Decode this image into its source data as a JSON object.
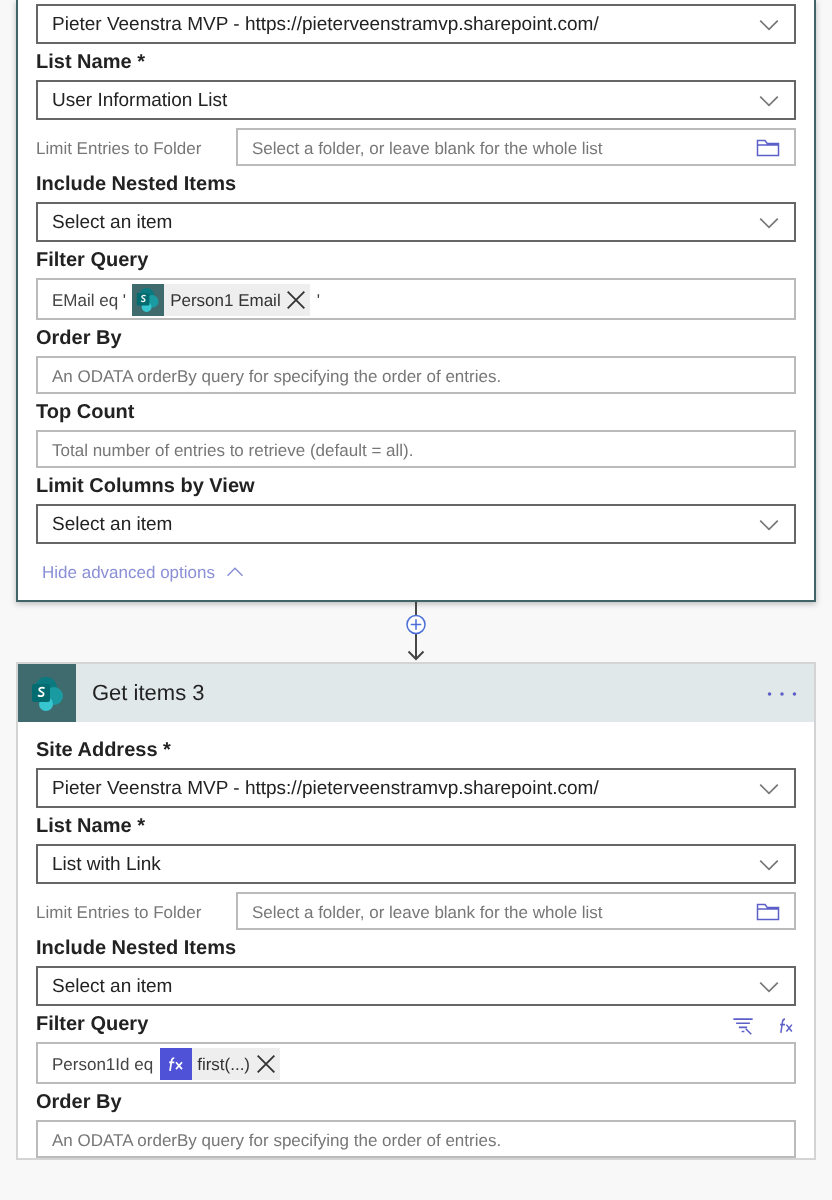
{
  "cards": [
    {
      "active": true,
      "fields": [
        {
          "kind": "dropdown",
          "value": "Pieter Veenstra MVP - https://pieterveenstramvp.sharepoint.com/"
        },
        {
          "kind": "dropdown",
          "label": "List Name *",
          "value": "User Information List"
        },
        {
          "kind": "folder",
          "label": "Limit Entries to Folder",
          "placeholder": "Select a folder, or leave blank for the whole list"
        },
        {
          "kind": "dropdown",
          "label": "Include Nested Items",
          "value": "Select an item"
        },
        {
          "kind": "tokens",
          "label": "Filter Query",
          "tools": false,
          "parts": [
            {
              "kind": "text",
              "text": "EMail eq '"
            },
            {
              "kind": "sharepoint",
              "text": "Person1 Email"
            },
            {
              "kind": "text",
              "text": "'"
            }
          ]
        },
        {
          "kind": "input",
          "label": "Order By",
          "placeholder": "An ODATA orderBy query for specifying the order of entries."
        },
        {
          "kind": "input",
          "label": "Top Count",
          "placeholder": "Total number of entries to retrieve (default = all)."
        },
        {
          "kind": "dropdown",
          "label": "Limit Columns by View",
          "value": "Select an item"
        }
      ],
      "advanced_link": "Hide advanced options"
    },
    {
      "active": false,
      "title": "Get items 3",
      "fields": [
        {
          "kind": "dropdown",
          "label": "Site Address *",
          "value": "Pieter Veenstra MVP - https://pieterveenstramvp.sharepoint.com/"
        },
        {
          "kind": "dropdown",
          "label": "List Name *",
          "value": "List with Link"
        },
        {
          "kind": "folder",
          "label": "Limit Entries to Folder",
          "placeholder": "Select a folder, or leave blank for the whole list"
        },
        {
          "kind": "dropdown",
          "label": "Include Nested Items",
          "value": "Select an item"
        },
        {
          "kind": "tokens",
          "label": "Filter Query",
          "tools": true,
          "parts": [
            {
              "kind": "text",
              "text": "Person1Id eq"
            },
            {
              "kind": "expression",
              "text": "first(...)"
            }
          ]
        },
        {
          "kind": "input",
          "label": "Order By",
          "placeholder": "An ODATA orderBy query for specifying the order of entries."
        }
      ]
    }
  ]
}
